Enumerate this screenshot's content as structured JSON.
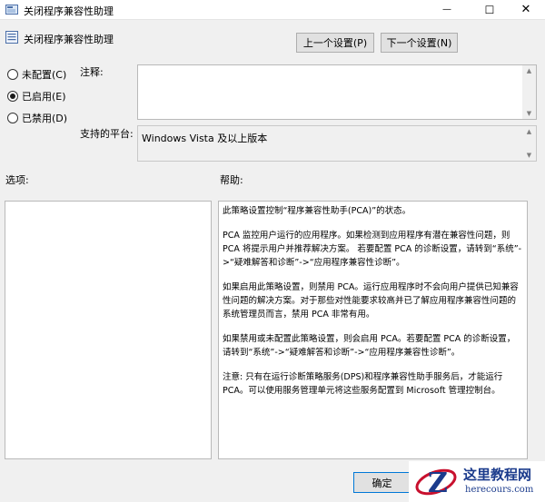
{
  "window": {
    "title": "关闭程序兼容性助理",
    "minimize_glyph": "—",
    "maximize_glyph": "☐",
    "close_glyph": "✕"
  },
  "policy": {
    "title": "关闭程序兼容性助理",
    "prev_button": "上一个设置(P)",
    "next_button": "下一个设置(N)"
  },
  "state": {
    "options": [
      {
        "label": "未配置(C)",
        "checked": false
      },
      {
        "label": "已启用(E)",
        "checked": true
      },
      {
        "label": "已禁用(D)",
        "checked": false
      }
    ]
  },
  "comment": {
    "label": "注释:",
    "value": ""
  },
  "platform": {
    "label": "支持的平台:",
    "value": "Windows Vista 及以上版本"
  },
  "options_section": {
    "label": "选项:"
  },
  "help_section": {
    "label": "帮助:",
    "paragraphs": [
      "此策略设置控制“程序兼容性助手(PCA)”的状态。",
      "PCA 监控用户运行的应用程序。如果检测到应用程序有潜在兼容性问题，则 PCA 将提示用户并推荐解决方案。 若要配置 PCA 的诊断设置，请转到“系统”->“疑难解答和诊断”->“应用程序兼容性诊断”。",
      "如果启用此策略设置，则禁用 PCA。运行应用程序时不会向用户提供已知兼容性问题的解决方案。对于那些对性能要求较高并已了解应用程序兼容性问题的系统管理员而言，禁用 PCA 非常有用。",
      "如果禁用或未配置此策略设置，则会启用 PCA。若要配置 PCA 的诊断设置，请转到“系统”->“疑难解答和诊断”->“应用程序兼容性诊断”。",
      "注意: 只有在运行诊断策略服务(DPS)和程序兼容性助手服务后，才能运行 PCA。可以使用服务管理单元将这些服务配置到 Microsoft 管理控制台。"
    ]
  },
  "footer": {
    "ok_button": "确定"
  },
  "watermark": {
    "title": "这里教程网",
    "url": "herecours.com"
  },
  "colors": {
    "accent": "#0078d7",
    "watermark": "#1b3b8c"
  }
}
